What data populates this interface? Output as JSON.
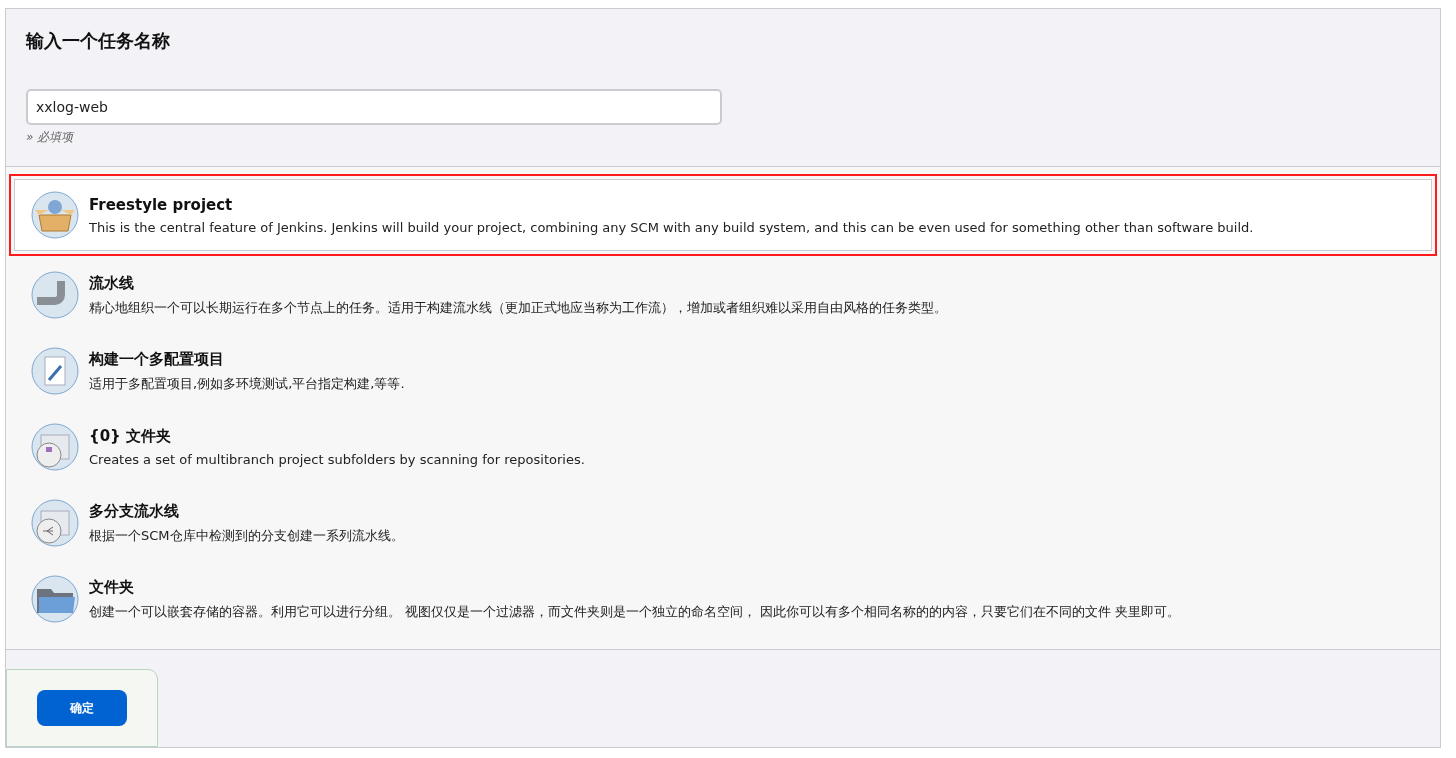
{
  "header": {
    "title": "输入一个任务名称",
    "name_field": {
      "value": "xxlog-web"
    },
    "hint": "» 必填项"
  },
  "items": [
    {
      "kind": "freestyle",
      "title": "Freestyle project",
      "description": "This is the central feature of Jenkins. Jenkins will build your project, combining any SCM with any build system, and this can be even used for something other than software build.",
      "selected": true
    },
    {
      "kind": "pipeline",
      "title": "流水线",
      "description": "精心地组织一个可以长期运行在多个节点上的任务。适用于构建流水线（更加正式地应当称为工作流），增加或者组织难以采用自由风格的任务类型。",
      "selected": false
    },
    {
      "kind": "matrix",
      "title": "构建一个多配置项目",
      "description": "适用于多配置项目,例如多环境测试,平台指定构建,等等.",
      "selected": false
    },
    {
      "kind": "org-folder",
      "title": "{0} 文件夹",
      "description": "Creates a set of multibranch project subfolders by scanning for repositories.",
      "selected": false
    },
    {
      "kind": "multibranch",
      "title": "多分支流水线",
      "description": "根据一个SCM仓库中检测到的分支创建一系列流水线。",
      "selected": false
    },
    {
      "kind": "folder",
      "title": "文件夹",
      "description": "创建一个可以嵌套存储的容器。利用它可以进行分组。 视图仅仅是一个过滤器，而文件夹则是一个独立的命名空间， 因此你可以有多个相同名称的的内容，只要它们在不同的文件 夹里即可。",
      "selected": false
    }
  ],
  "footer": {
    "ok_button": "确定"
  }
}
